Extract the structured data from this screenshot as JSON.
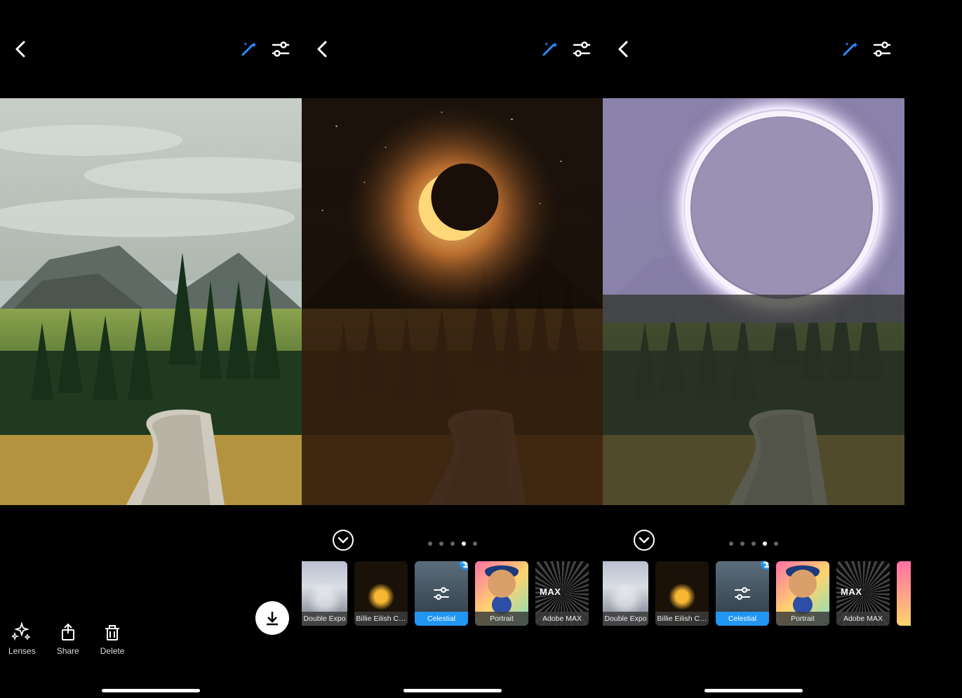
{
  "panels": [
    {
      "actions": {
        "lenses": "Lenses",
        "share": "Share",
        "delete": "Delete"
      }
    },
    {
      "pager_active": 3,
      "pager_count": 5,
      "lenses": [
        {
          "label": "Double Expo",
          "selected": false,
          "kind": "expo"
        },
        {
          "label": "Billie Eilish C…",
          "selected": false,
          "kind": "billie"
        },
        {
          "label": "Celestial",
          "selected": true,
          "kind": "celest",
          "badge": true
        },
        {
          "label": "Portrait",
          "selected": false,
          "kind": "portrait"
        },
        {
          "label": "Adobe MAX",
          "selected": false,
          "kind": "max"
        }
      ]
    },
    {
      "pager_active": 3,
      "pager_count": 5,
      "lenses": [
        {
          "label": "Double Expo",
          "selected": false,
          "kind": "expo"
        },
        {
          "label": "Billie Eilish C…",
          "selected": false,
          "kind": "billie"
        },
        {
          "label": "Celestial",
          "selected": true,
          "kind": "celest",
          "badge": true
        },
        {
          "label": "Portrait",
          "selected": false,
          "kind": "portrait"
        },
        {
          "label": "Adobe MAX",
          "selected": false,
          "kind": "max"
        }
      ]
    }
  ],
  "colors": {
    "accent": "#2196f3",
    "wand": "#2b8eff"
  },
  "max_text": "MAX"
}
